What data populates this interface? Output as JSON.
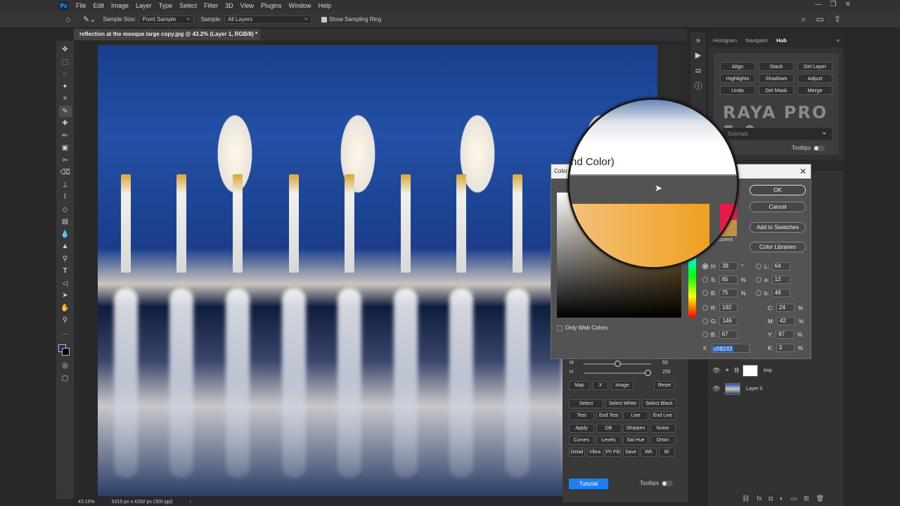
{
  "menu": [
    "File",
    "Edit",
    "Image",
    "Layer",
    "Type",
    "Select",
    "Filter",
    "3D",
    "View",
    "Plugins",
    "Window",
    "Help"
  ],
  "options": {
    "sample_size_label": "Sample Size:",
    "sample_size_value": "Point Sample",
    "sample_label": "Sample:",
    "sample_value": "All Layers",
    "sampling_ring_label": "Show Sampling Ring"
  },
  "document": {
    "tab_title": "reflection at the mosque large copy.jpg @ 43.2% (Layer 1, RGB/8) *",
    "zoom": "43.15%",
    "dimensions": "5315 px x 4292 px (300 ppi)"
  },
  "panel_tabs": [
    "Histogram",
    "Navigator",
    "Hub"
  ],
  "raya": {
    "buttons": [
      "Align",
      "Stack",
      "Del Layer",
      "Highlights",
      "Shadows",
      "Adjust",
      "Undo",
      "Del Mask",
      "Merge"
    ],
    "logo": "RAYA PRO 5.0",
    "tutorials_placeholder": "Tutorials",
    "tooltips_label": "Tooltips"
  },
  "raya_lower": {
    "m_label": "M",
    "m_value": "50",
    "h_label": "H",
    "h_value": "255",
    "row1": [
      "Map",
      "X",
      "Image",
      "Reset"
    ],
    "grid": [
      "Select",
      "Select White",
      "Select Black",
      "Test",
      "End Test",
      "Live",
      "End Live",
      "Apply",
      "DB",
      "Sharpen",
      "Noise",
      "Curves",
      "Levels",
      "Sat Hue",
      "Orton",
      "Detail",
      "Vibra",
      "Ph Filt",
      "Save",
      "Wh",
      "Bl",
      "Sm",
      "La",
      "+",
      "-"
    ],
    "tutorial_button": "Tutorial",
    "tooltips_label": "Tooltips"
  },
  "layers": [
    {
      "name": "tmp"
    },
    {
      "name": "Layer 0"
    }
  ],
  "color_dialog": {
    "title": "Color Picker (Foreground Color)",
    "ok": "OK",
    "cancel": "Cancel",
    "add_to_swatches": "Add to Swatches",
    "color_libraries": "Color Libraries",
    "only_web_colors": "Only Web Colors",
    "current_label": "current",
    "fields": {
      "H": "38",
      "S": "65",
      "B": "75",
      "R": "192",
      "G": "146",
      "B2": "67",
      "L": "64",
      "a": "12",
      "b": "48",
      "C": "24",
      "M": "42",
      "Y": "87",
      "K": "3"
    },
    "units": {
      "deg": "°",
      "pct": "%"
    },
    "hex": "c09243",
    "new_color": "#ec1d4b",
    "current_color": "#c09243"
  },
  "magnifier": {
    "title_text": "nd Color)"
  },
  "colors": {
    "accent": "#1f7ff0",
    "foreground": "#1a2c6b",
    "background": "#000000"
  }
}
